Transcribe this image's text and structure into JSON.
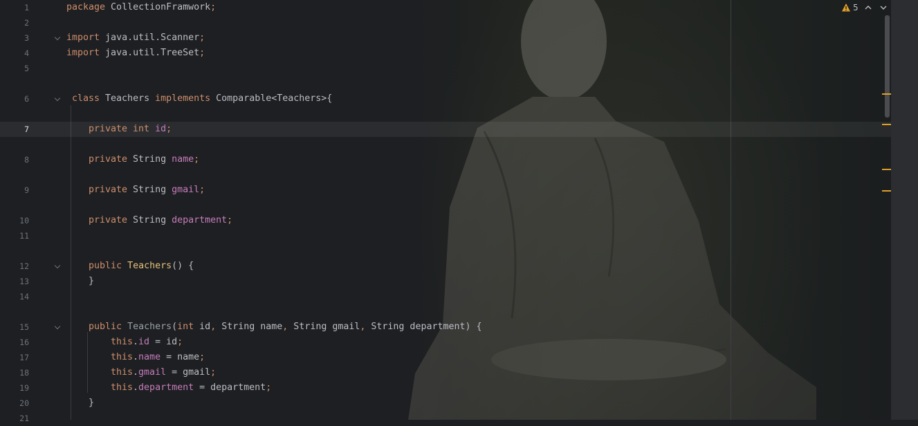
{
  "inspections": {
    "warning_count": "5",
    "warning_icon": "warning-triangle-icon",
    "up_icon": "chevron-up-icon",
    "down_icon": "chevron-down-icon"
  },
  "colors": {
    "keyword": "#cf8e6d",
    "field": "#c77dbb",
    "method": "#e8c17a",
    "text": "#bcbec4",
    "marker": "#e0a028"
  },
  "lines": [
    {
      "num": "1",
      "t": [
        "package",
        " CollectionFramwork",
        ";"
      ]
    },
    {
      "num": "2",
      "t": []
    },
    {
      "num": "3",
      "t": [
        "import",
        " java.util.Scanner",
        ";"
      ]
    },
    {
      "num": "4",
      "t": [
        "import",
        " java.util.TreeSet",
        ";"
      ]
    },
    {
      "num": "5",
      "t": []
    },
    {
      "num": "6",
      "t": [
        "class",
        " Teachers ",
        "implements",
        " Comparable<Teachers>{"
      ]
    },
    {
      "num": "7",
      "t": [
        "private int",
        " ",
        "id",
        ";"
      ]
    },
    {
      "num": "8",
      "t": [
        "private",
        " String ",
        "name",
        ";"
      ]
    },
    {
      "num": "9",
      "t": [
        "private",
        " String ",
        "gmail",
        ";"
      ]
    },
    {
      "num": "10",
      "t": [
        "private",
        " String ",
        "department",
        ";"
      ]
    },
    {
      "num": "11",
      "t": []
    },
    {
      "num": "12",
      "t": [
        "public",
        " ",
        "Teachers",
        "() {"
      ]
    },
    {
      "num": "13",
      "t": [
        "}"
      ]
    },
    {
      "num": "14",
      "t": []
    },
    {
      "num": "15",
      "t": [
        "public",
        " ",
        "Teachers",
        "(",
        "int",
        " id",
        ",",
        " String name",
        ",",
        " String gmail",
        ",",
        " String department) {"
      ]
    },
    {
      "num": "16",
      "t": [
        "this",
        ".",
        "id",
        " = id",
        ";"
      ]
    },
    {
      "num": "17",
      "t": [
        "this",
        ".",
        "name",
        " = name",
        ";"
      ]
    },
    {
      "num": "18",
      "t": [
        "this",
        ".",
        "gmail",
        " = gmail",
        ";"
      ]
    },
    {
      "num": "19",
      "t": [
        "this",
        ".",
        "department",
        " = department",
        ";"
      ]
    },
    {
      "num": "20",
      "t": [
        "}"
      ]
    },
    {
      "num": "21",
      "t": []
    }
  ]
}
